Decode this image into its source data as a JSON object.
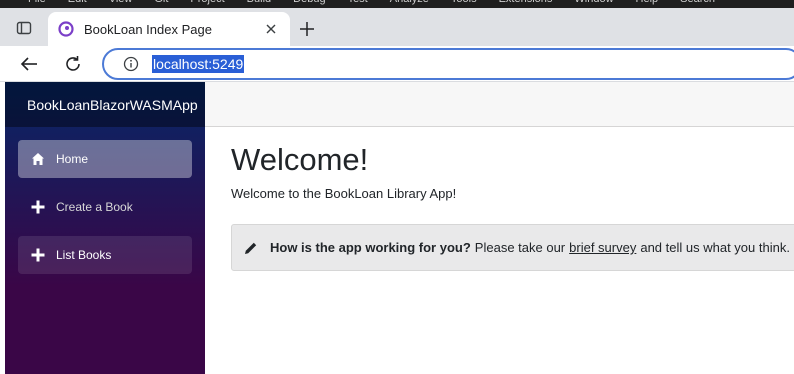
{
  "ide": {
    "menu": [
      "File",
      "Edit",
      "View",
      "Git",
      "Project",
      "Build",
      "Debug",
      "Test",
      "Analyze",
      "Tools",
      "Extensions",
      "Window",
      "Help",
      "Search"
    ]
  },
  "browser": {
    "tab_title": "BookLoan Index Page",
    "url": "localhost:5249"
  },
  "app": {
    "brand": "BookLoanBlazorWASMApp",
    "nav": [
      {
        "label": "Home",
        "icon": "home-icon",
        "state": "active"
      },
      {
        "label": "Create a Book",
        "icon": "plus-icon",
        "state": "normal"
      },
      {
        "label": "List Books",
        "icon": "plus-icon",
        "state": "hover"
      }
    ],
    "page_title": "Welcome!",
    "welcome_text": "Welcome to the BookLoan Library App!",
    "survey": {
      "question": "How is the app working for you?",
      "prefix": "Please take our",
      "link": "brief survey",
      "suffix": "and tell us what you think."
    }
  },
  "colors": {
    "sidebar_top": "#052767",
    "sidebar_bottom": "#3a0647",
    "url_highlight": "#2a5fd6",
    "omnibox_border": "#4c7ad6"
  }
}
